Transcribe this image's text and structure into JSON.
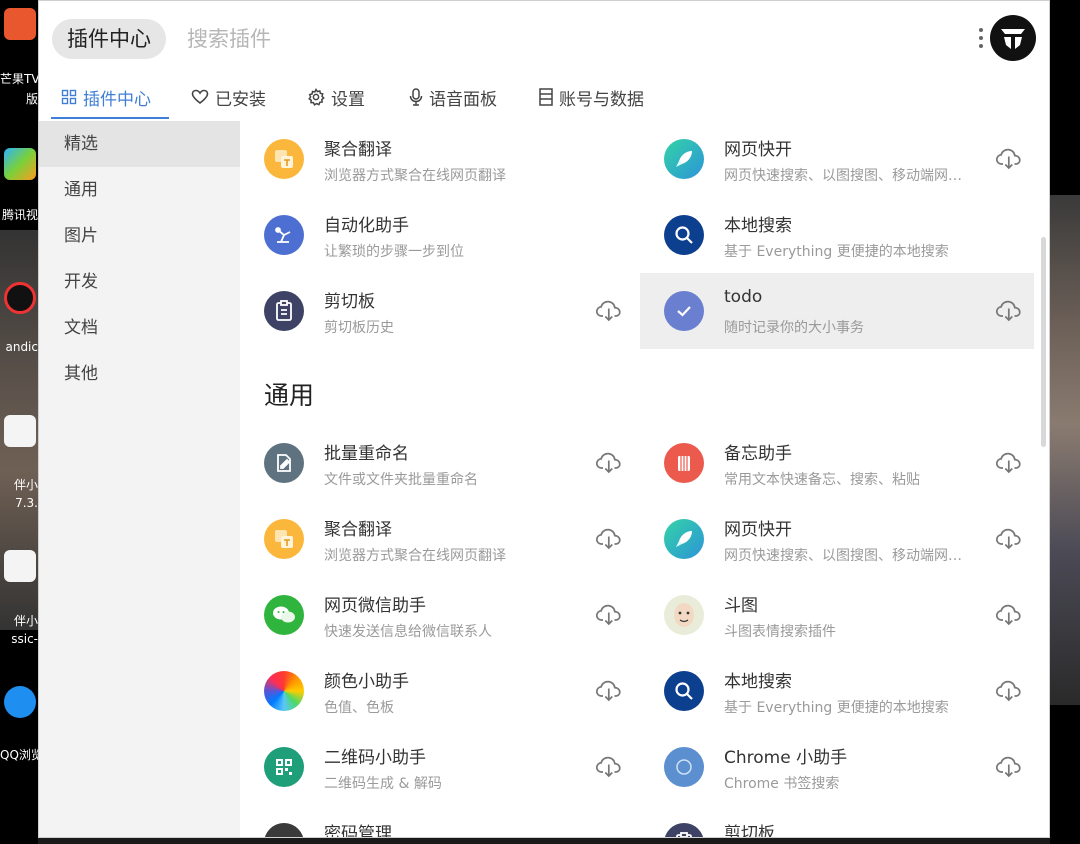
{
  "colors": {
    "accent": "#3f7fd6",
    "sidebar_bg": "#f3f3f3",
    "selected_bg": "#e4e4e4"
  },
  "desktop": {
    "icons": [
      {
        "name": "芒果TV",
        "label_lines": [
          "芒果TV",
          "版"
        ]
      },
      {
        "name": "腾讯视频",
        "label_lines": [
          "腾讯视"
        ]
      },
      {
        "name": "Bandicam",
        "label_lines": [
          "andic"
        ]
      },
      {
        "name": "伴小",
        "label_lines": [
          "伴小",
          "7.3."
        ]
      },
      {
        "name": "伴小 classic",
        "label_lines": [
          "伴小",
          "ssic-"
        ]
      },
      {
        "name": "QQ浏览器",
        "label_lines": [
          "QQ浏览"
        ]
      }
    ]
  },
  "header": {
    "app_chip": "插件中心",
    "search_placeholder": "搜索插件",
    "more_icon": "vertical-dots-icon",
    "logo_icon": "utools-logo-icon"
  },
  "tabs": [
    {
      "label": "插件中心",
      "icon": "grid-icon",
      "active": true
    },
    {
      "label": "已安装",
      "icon": "heart-icon",
      "active": false
    },
    {
      "label": "设置",
      "icon": "gear-icon",
      "active": false
    },
    {
      "label": "语音面板",
      "icon": "microphone-icon",
      "active": false
    },
    {
      "label": "账号与数据",
      "icon": "document-icon",
      "active": false
    }
  ],
  "sidebar": {
    "items": [
      {
        "label": "精选",
        "active": true
      },
      {
        "label": "通用",
        "active": false
      },
      {
        "label": "图片",
        "active": false
      },
      {
        "label": "开发",
        "active": false
      },
      {
        "label": "文档",
        "active": false
      },
      {
        "label": "其他",
        "active": false
      }
    ]
  },
  "featured": [
    {
      "name": "聚合翻译",
      "desc": "浏览器方式聚合在线网页翻译",
      "icon": "translate-icon",
      "download": false
    },
    {
      "name": "网页快开",
      "desc": "网页快速搜索、以图搜图、移动端网页调试",
      "icon": "rocket-icon",
      "download": true
    },
    {
      "name": "自动化助手",
      "desc": "让繁琐的步骤一步到位",
      "icon": "robot-arm-icon",
      "download": false
    },
    {
      "name": "本地搜索",
      "desc": "基于 Everything 更便捷的本地搜索",
      "icon": "magnifier-icon",
      "download": false
    },
    {
      "name": "剪切板",
      "desc": "剪切板历史",
      "icon": "clipboard-icon",
      "download": true
    },
    {
      "name": "todo",
      "desc": "随时记录你的大小事务",
      "icon": "check-icon",
      "download": true
    }
  ],
  "section_general": {
    "title": "通用",
    "items": [
      {
        "name": "批量重命名",
        "desc": "文件或文件夹批量重命名",
        "icon": "rename-icon"
      },
      {
        "name": "备忘助手",
        "desc": "常用文本快速备忘、搜索、粘贴",
        "icon": "memo-icon"
      },
      {
        "name": "聚合翻译",
        "desc": "浏览器方式聚合在线网页翻译",
        "icon": "translate-icon"
      },
      {
        "name": "网页快开",
        "desc": "网页快速搜索、以图搜图、移动端网页调试",
        "icon": "rocket-icon"
      },
      {
        "name": "网页微信助手",
        "desc": "快速发送信息给微信联系人",
        "icon": "wechat-icon"
      },
      {
        "name": "斗图",
        "desc": "斗图表情搜索插件",
        "icon": "meme-face-icon"
      },
      {
        "name": "颜色小助手",
        "desc": "色值、色板",
        "icon": "color-wheel-icon"
      },
      {
        "name": "本地搜索",
        "desc": "基于 Everything 更便捷的本地搜索",
        "icon": "magnifier-icon"
      },
      {
        "name": "二维码小助手",
        "desc": "二维码生成 & 解码",
        "icon": "qrcode-icon"
      },
      {
        "name": "Chrome 小助手",
        "desc": "Chrome 书签搜索",
        "icon": "chrome-circle-icon"
      },
      {
        "name": "密码管理",
        "desc": "",
        "icon": "password-icon"
      },
      {
        "name": "剪切板",
        "desc": "",
        "icon": "clipboard-icon"
      }
    ]
  }
}
